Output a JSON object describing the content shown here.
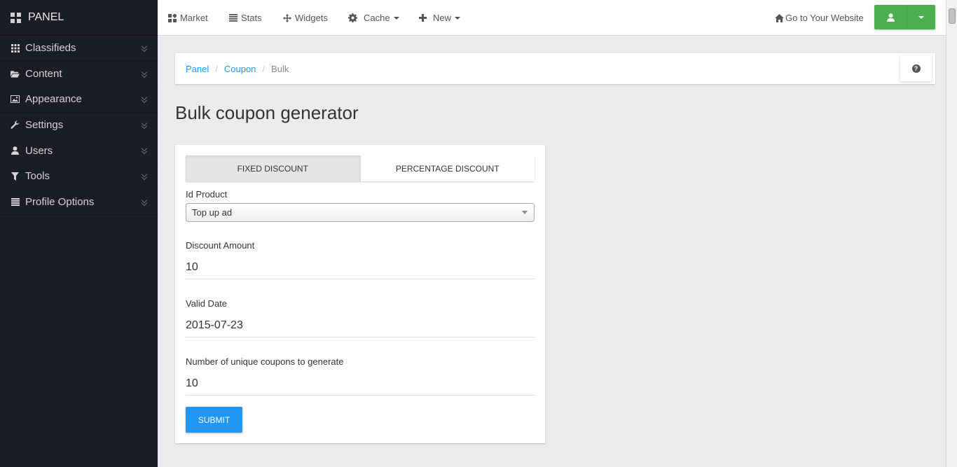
{
  "sidebar": {
    "brand": "PANEL",
    "items": [
      {
        "label": "Classifieds",
        "icon": "grid-icon"
      },
      {
        "label": "Content",
        "icon": "folder-open-icon"
      },
      {
        "label": "Appearance",
        "icon": "picture-icon"
      },
      {
        "label": "Settings",
        "icon": "wrench-icon"
      },
      {
        "label": "Users",
        "icon": "user-icon"
      },
      {
        "label": "Tools",
        "icon": "filter-icon"
      },
      {
        "label": "Profile Options",
        "icon": "list-icon"
      }
    ]
  },
  "topbar": {
    "market": "Market",
    "stats": "Stats",
    "widgets": "Widgets",
    "cache": "Cache",
    "new": "New",
    "website": "Go to Your Website",
    "accent_color": "#4caf50"
  },
  "breadcrumb": {
    "items": [
      "Panel",
      "Coupon"
    ],
    "current": "Bulk"
  },
  "page": {
    "title": "Bulk coupon generator"
  },
  "form": {
    "tabs": {
      "fixed": "Fixed Discount",
      "percentage": "Percentage Discount",
      "active": "fixed"
    },
    "id_product": {
      "label": "Id Product",
      "value": "Top up ad"
    },
    "discount_amount": {
      "label": "Discount Amount",
      "value": "10"
    },
    "valid_date": {
      "label": "Valid Date",
      "value": "2015-07-23"
    },
    "num_coupons": {
      "label": "Number of unique coupons to generate",
      "value": "10"
    },
    "submit": "Submit",
    "submit_color": "#2196f3"
  }
}
